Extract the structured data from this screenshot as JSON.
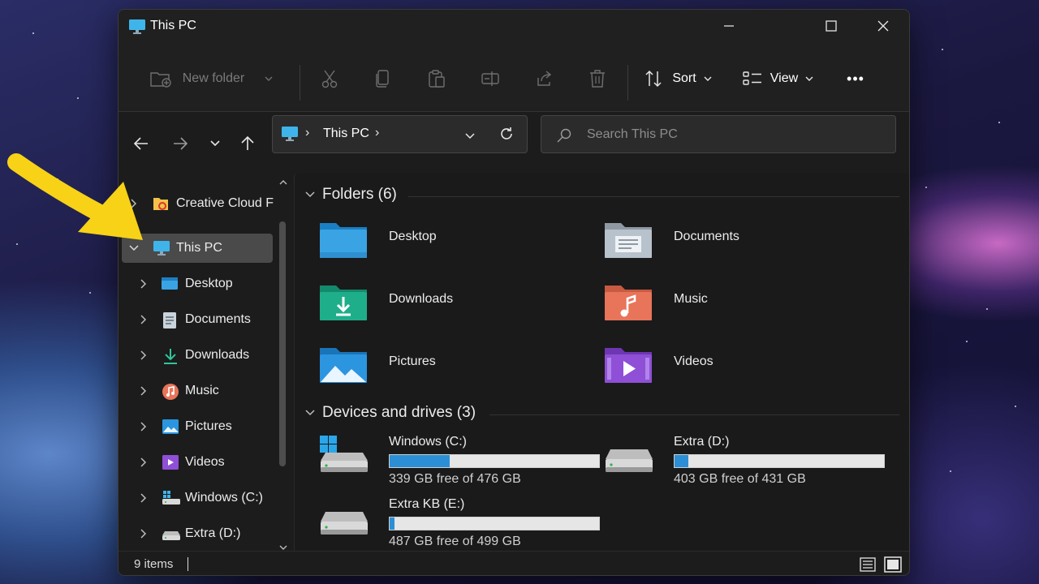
{
  "window": {
    "title": "This PC"
  },
  "toolbar": {
    "new_folder": "New folder",
    "sort": "Sort",
    "view": "View",
    "more": "•••"
  },
  "address": {
    "location": "This PC",
    "separator": "›"
  },
  "search": {
    "placeholder": "Search This PC"
  },
  "sidebar": {
    "items": [
      {
        "label": "Creative Cloud F",
        "icon": "creative-cloud-icon"
      },
      {
        "label": "This PC",
        "icon": "monitor-icon",
        "selected": true,
        "expanded": true
      },
      {
        "label": "Desktop",
        "icon": "desktop-folder-icon"
      },
      {
        "label": "Documents",
        "icon": "documents-icon"
      },
      {
        "label": "Downloads",
        "icon": "download-icon"
      },
      {
        "label": "Music",
        "icon": "music-icon"
      },
      {
        "label": "Pictures",
        "icon": "pictures-icon"
      },
      {
        "label": "Videos",
        "icon": "videos-icon"
      },
      {
        "label": "Windows (C:)",
        "icon": "drive-c-icon"
      },
      {
        "label": "Extra (D:)",
        "icon": "drive-icon"
      }
    ]
  },
  "content": {
    "folders_header": "Folders (6)",
    "folders": [
      {
        "label": "Desktop",
        "icon": "desktop-folder-icon",
        "color": "#3aa3e3"
      },
      {
        "label": "Documents",
        "icon": "documents-folder-icon",
        "color": "#b8c2cc"
      },
      {
        "label": "Downloads",
        "icon": "downloads-folder-icon",
        "color": "#1fae8a"
      },
      {
        "label": "Music",
        "icon": "music-folder-icon",
        "color": "#e8745a"
      },
      {
        "label": "Pictures",
        "icon": "pictures-folder-icon",
        "color": "#2b95e0"
      },
      {
        "label": "Videos",
        "icon": "videos-folder-icon",
        "color": "#8f4fd6"
      }
    ],
    "drives_header": "Devices and drives (3)",
    "drives": [
      {
        "name": "Windows (C:)",
        "free": "339 GB free of 476 GB",
        "used_fraction": 0.288
      },
      {
        "name": "Extra (D:)",
        "free": "403 GB free of 431 GB",
        "used_fraction": 0.065
      },
      {
        "name": "Extra KB (E:)",
        "free": "487 GB free of 499 GB",
        "used_fraction": 0.024
      }
    ]
  },
  "status": {
    "items": "9 items"
  },
  "colors": {
    "accent": "#2c8fd6",
    "arrow": "#f7d216",
    "window_bg": "#1c1c1c"
  }
}
